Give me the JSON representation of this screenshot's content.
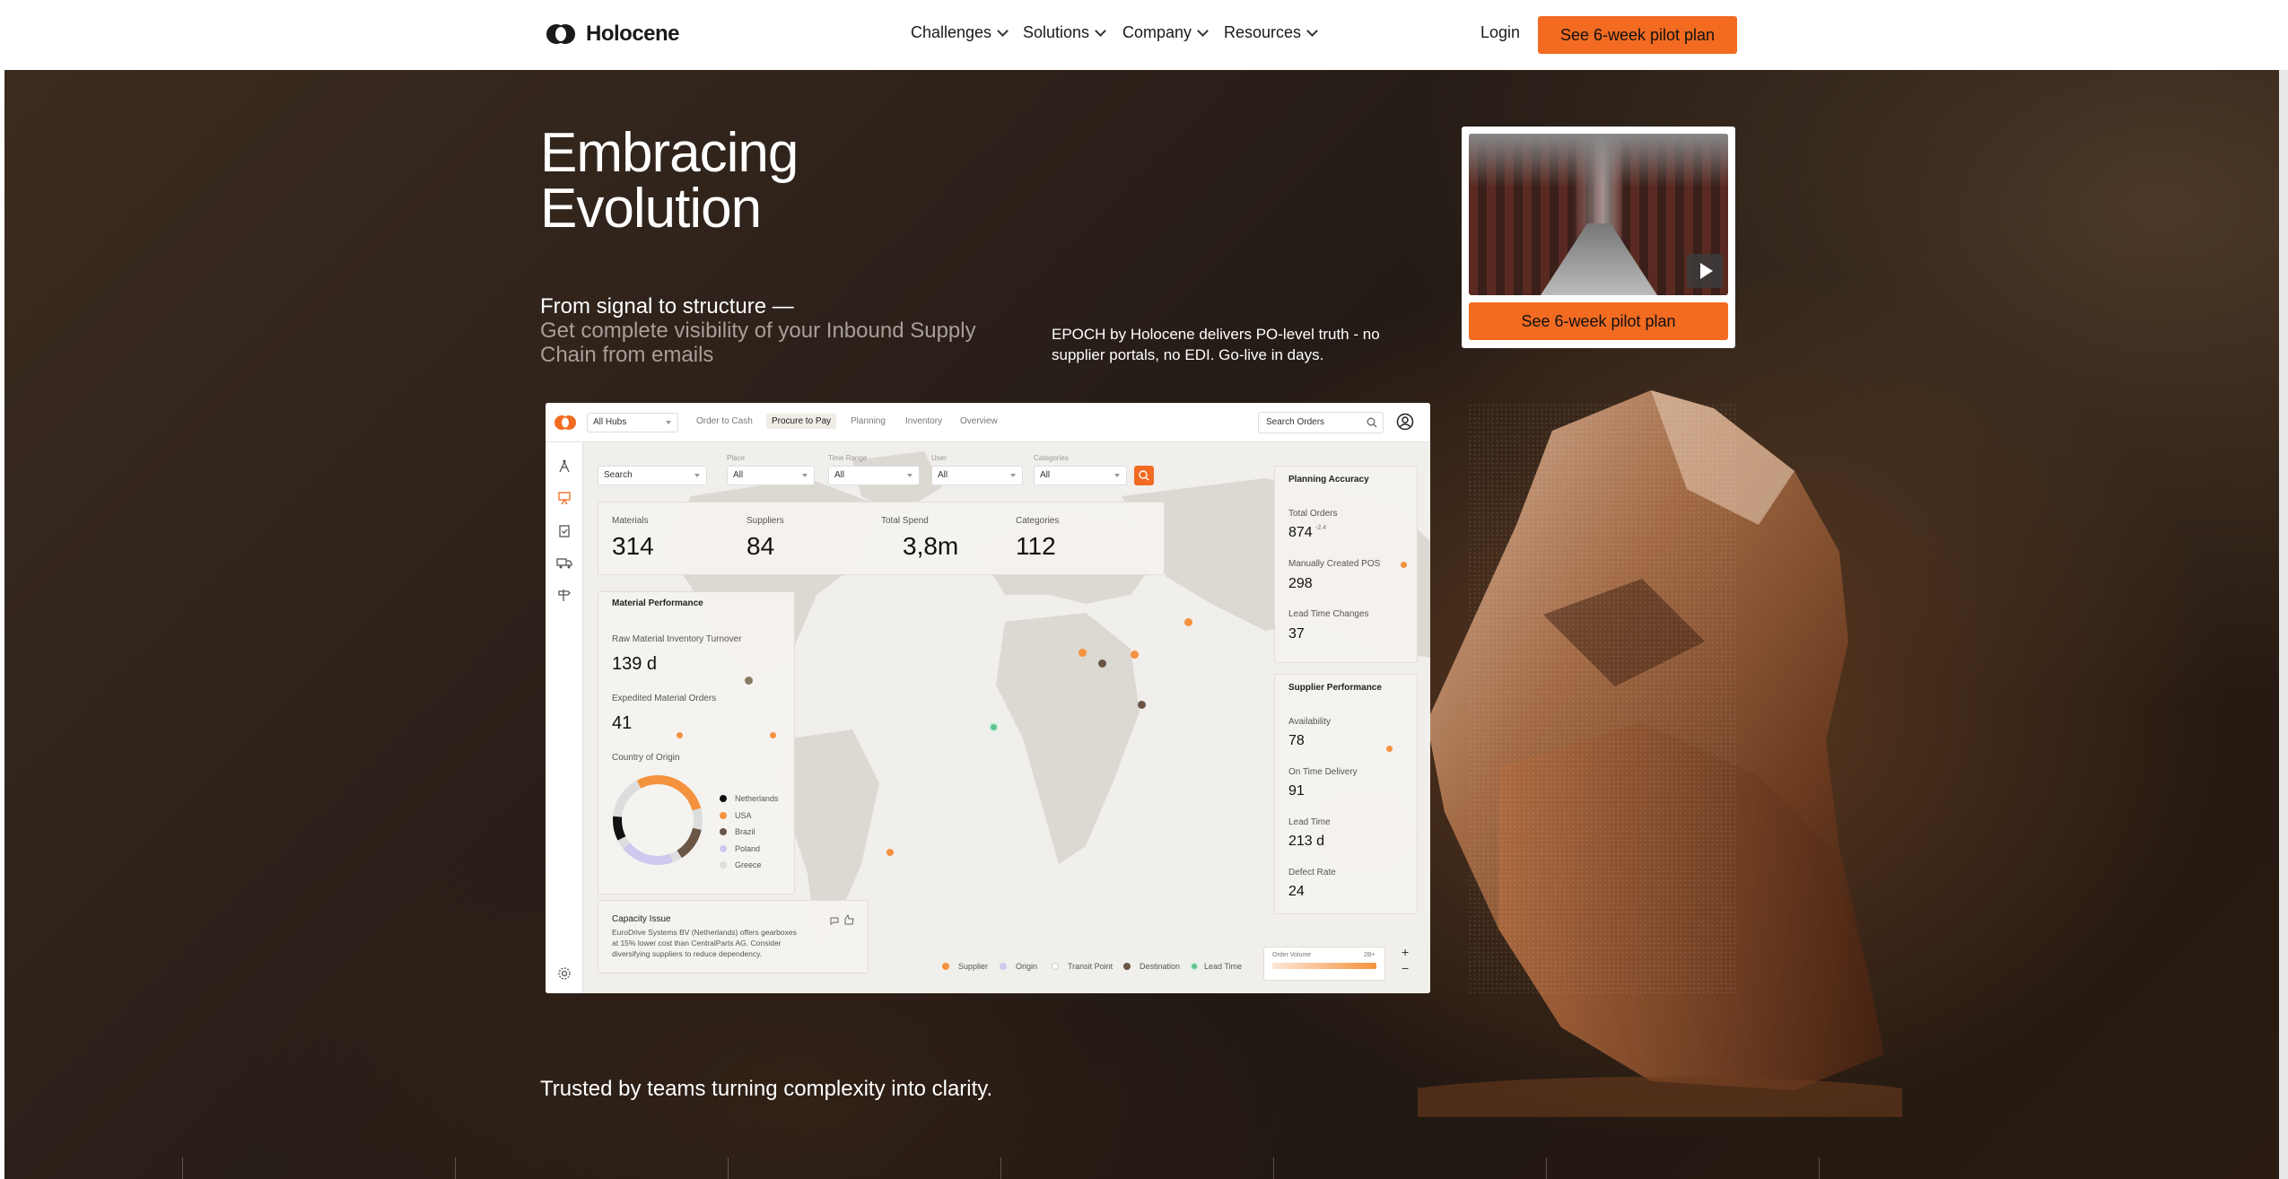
{
  "brand": {
    "name": "Holocene"
  },
  "nav": {
    "items": [
      "Challenges",
      "Solutions",
      "Company",
      "Resources"
    ],
    "login": "Login",
    "cta": "See 6-week pilot plan"
  },
  "hero": {
    "title_line1": "Embracing",
    "title_line2": "Evolution",
    "subtitle_strong": "From signal to structure —",
    "subtitle_muted": "Get complete visibility of your Inbound Supply Chain from emails",
    "epoch_text": "EPOCH by Holocene delivers PO-level truth - no supplier portals, no EDI. Go-live in days.",
    "video_cta": "See 6-week pilot plan",
    "trusted": "Trusted by teams turning complexity into clarity."
  },
  "dashboard": {
    "hub_select": "All Hubs",
    "tabs": [
      "Order to Cash",
      "Procure to Pay",
      "Planning",
      "Inventory",
      "Overview"
    ],
    "active_tab": "Procure to Pay",
    "search_orders": "Search Orders",
    "filters": {
      "search": "Search",
      "place_label": "Place",
      "place_value": "All",
      "time_label": "Time Range",
      "time_value": "All",
      "user_label": "User",
      "user_value": "All",
      "cat_label": "Categories",
      "cat_value": "All"
    },
    "kpis": [
      {
        "label": "Materials",
        "value": "314"
      },
      {
        "label": "Suppliers",
        "value": "84"
      },
      {
        "label": "Total Spend",
        "value": "3,8m"
      },
      {
        "label": "Categories",
        "value": "112"
      }
    ],
    "material_performance": {
      "title": "Material Performance",
      "turnover_label": "Raw Material Inventory Turnover",
      "turnover_value": "139 d",
      "expedited_label": "Expedited Material Orders",
      "expedited_value": "41",
      "origin_label": "Country of Origin",
      "origin_legend": [
        "Netherlands",
        "USA",
        "Brazil",
        "Poland",
        "Greece"
      ],
      "origin_colors": [
        "#111111",
        "#f5923e",
        "#6b5544",
        "#cfc8ef",
        "#dddddd"
      ]
    },
    "planning_accuracy": {
      "title": "Planning Accuracy",
      "total_orders_label": "Total Orders",
      "total_orders_value": "874",
      "total_orders_delta": "-2.4",
      "manual_label": "Manually Created POS",
      "manual_value": "298",
      "lead_changes_label": "Lead Time Changes",
      "lead_changes_value": "37"
    },
    "supplier_performance": {
      "title": "Supplier Performance",
      "availability_label": "Availability",
      "availability_value": "78",
      "ontime_label": "On Time Delivery",
      "ontime_value": "91",
      "leadtime_label": "Lead Time",
      "leadtime_value": "213 d",
      "defect_label": "Defect Rate",
      "defect_value": "24"
    },
    "capacity": {
      "title": "Capacity Issue",
      "text": "EuroDrive Systems BV (Netherlands) offers gearboxes at 15% lower cost than CentralParts AG. Consider diversifying suppliers to reduce dependency."
    },
    "map_legend": [
      "Supplier",
      "Origin",
      "Transit Point",
      "Destination",
      "Lead Time"
    ],
    "order_volume": {
      "label": "Order Volume",
      "value": "2B+"
    },
    "zoom_in": "+",
    "zoom_out": "−"
  }
}
